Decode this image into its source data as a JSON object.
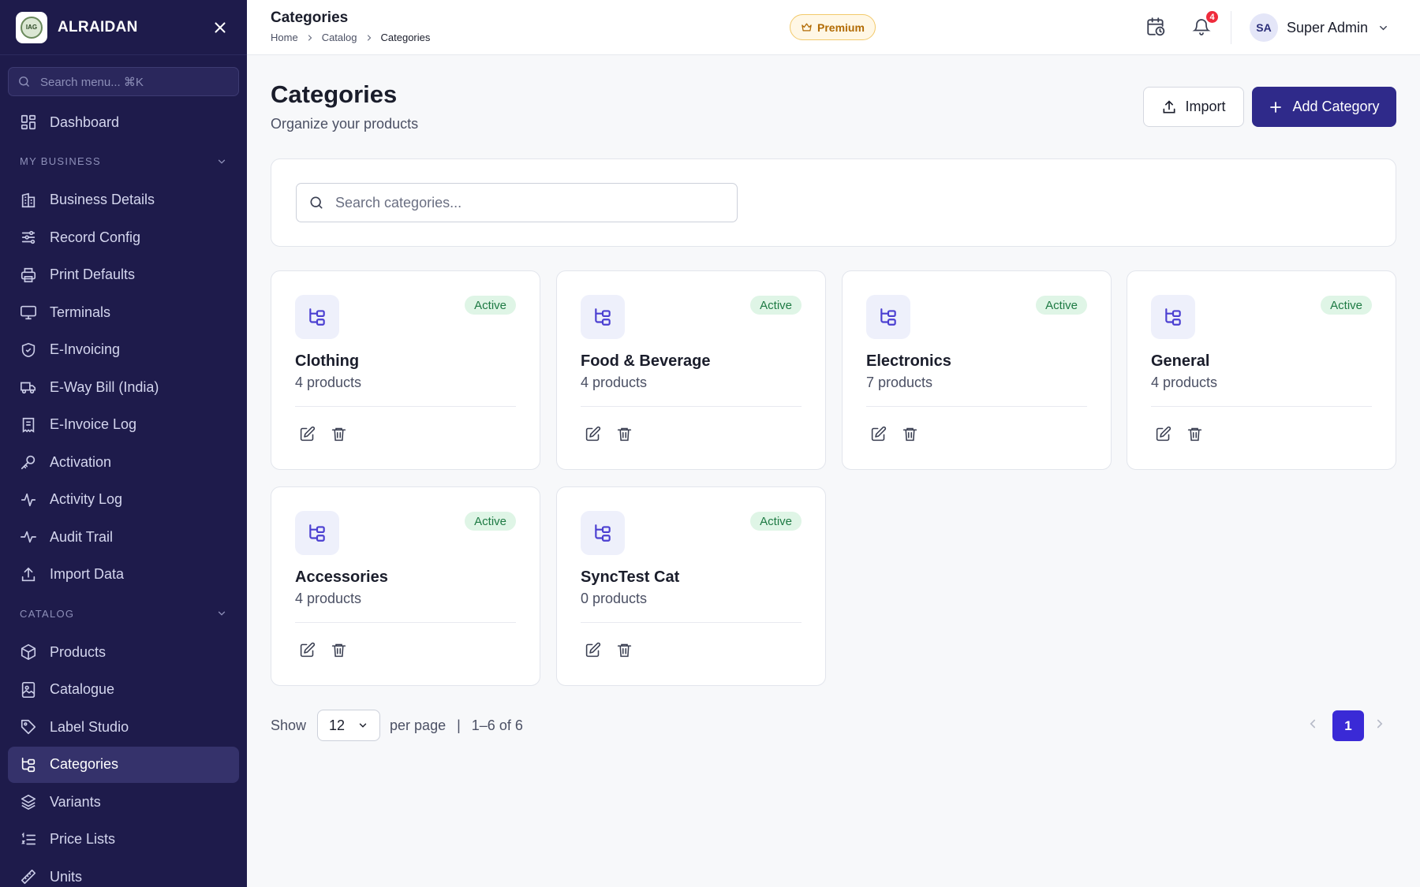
{
  "sidebar": {
    "brand": "ALRAIDAN",
    "logo_text": "IAG",
    "search_placeholder": "Search menu... ⌘K",
    "top_items": [
      {
        "label": "Dashboard",
        "icon": "dashboard-icon"
      }
    ],
    "sections": [
      {
        "title": "MY BUSINESS",
        "items": [
          {
            "label": "Business Details",
            "icon": "building-icon"
          },
          {
            "label": "Record Config",
            "icon": "sliders-icon"
          },
          {
            "label": "Print Defaults",
            "icon": "printer-icon"
          },
          {
            "label": "Terminals",
            "icon": "monitor-icon"
          },
          {
            "label": "E-Invoicing",
            "icon": "shield-check-icon"
          },
          {
            "label": "E-Way Bill (India)",
            "icon": "truck-icon"
          },
          {
            "label": "E-Invoice Log",
            "icon": "receipt-icon"
          },
          {
            "label": "Activation",
            "icon": "key-icon"
          },
          {
            "label": "Activity Log",
            "icon": "activity-icon"
          },
          {
            "label": "Audit Trail",
            "icon": "pulse-icon"
          },
          {
            "label": "Import Data",
            "icon": "upload-icon"
          }
        ]
      },
      {
        "title": "CATALOG",
        "items": [
          {
            "label": "Products",
            "icon": "box-icon"
          },
          {
            "label": "Catalogue",
            "icon": "image-book-icon"
          },
          {
            "label": "Label Studio",
            "icon": "tag-icon"
          },
          {
            "label": "Categories",
            "icon": "category-tree-icon"
          },
          {
            "label": "Variants",
            "icon": "layers-icon"
          },
          {
            "label": "Price Lists",
            "icon": "list-ordered-icon"
          },
          {
            "label": "Units",
            "icon": "ruler-icon"
          }
        ]
      }
    ]
  },
  "topbar": {
    "title": "Categories",
    "breadcrumb": [
      "Home",
      "Catalog",
      "Categories"
    ],
    "premium_label": "Premium",
    "notification_count": "4",
    "user_initials": "SA",
    "user_name": "Super Admin"
  },
  "main": {
    "title": "Categories",
    "subtitle": "Organize your products",
    "import_label": "Import",
    "add_label": "Add Category",
    "search_placeholder": "Search categories..."
  },
  "categories": [
    {
      "name": "Clothing",
      "count": "4 products",
      "status": "Active"
    },
    {
      "name": "Food & Beverage",
      "count": "4 products",
      "status": "Active"
    },
    {
      "name": "Electronics",
      "count": "7 products",
      "status": "Active"
    },
    {
      "name": "General",
      "count": "4 products",
      "status": "Active"
    },
    {
      "name": "Accessories",
      "count": "4 products",
      "status": "Active"
    },
    {
      "name": "SyncTest Cat",
      "count": "0 products",
      "status": "Active"
    }
  ],
  "pagination": {
    "show_label": "Show",
    "per_page_value": "12",
    "per_page_label": "per page",
    "separator": "|",
    "range_text": "1–6 of 6",
    "current_page": "1"
  },
  "colors": {
    "sidebar_bg": "#1e1b4b",
    "primary_button": "#2f2a8a",
    "active_badge_bg": "#dff5e6",
    "page_active": "#3a2ad6",
    "notification_badge": "#ef2b3c"
  }
}
